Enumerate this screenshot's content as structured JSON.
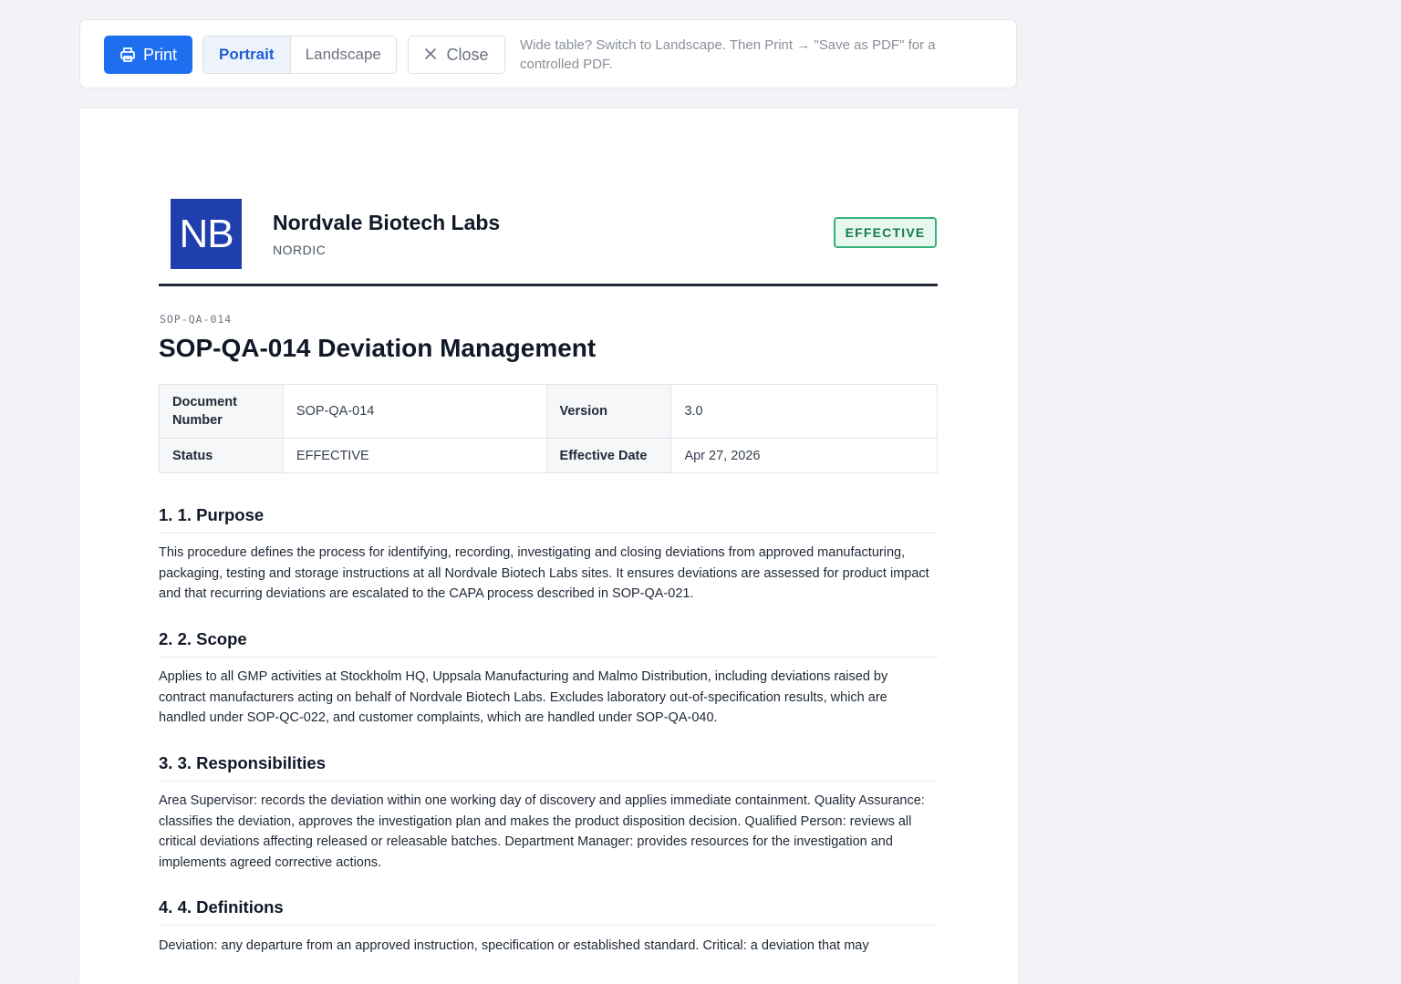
{
  "toolbar": {
    "print_label": "Print",
    "portrait_label": "Portrait",
    "landscape_label": "Landscape",
    "close_label": "Close",
    "hint": "Wide table? Switch to Landscape. Then Print → \"Save as PDF\" for a controlled PDF.",
    "print_icon": "printer-icon",
    "close_icon": "close-icon",
    "selected_orientation": "Portrait"
  },
  "header": {
    "logo_text": "NB",
    "company_name": "Nordvale Biotech Labs",
    "region": "NORDIC",
    "status_badge": "EFFECTIVE"
  },
  "document": {
    "code": "SOP-QA-014",
    "title": "SOP-QA-014 Deviation Management",
    "meta": {
      "doc_number_label": "Document Number",
      "doc_number_value": "SOP-QA-014",
      "version_label": "Version",
      "version_value": "3.0",
      "status_label": "Status",
      "status_value": "EFFECTIVE",
      "effective_date_label": "Effective Date",
      "effective_date_value": "Apr 27, 2026"
    },
    "sections": [
      {
        "title": "1. 1. Purpose",
        "body": "This procedure defines the process for identifying, recording, investigating and closing deviations from approved manufacturing, packaging, testing and storage instructions at all Nordvale Biotech Labs sites. It ensures deviations are assessed for product impact and that recurring deviations are escalated to the CAPA process described in SOP-QA-021."
      },
      {
        "title": "2. 2. Scope",
        "body": "Applies to all GMP activities at Stockholm HQ, Uppsala Manufacturing and Malmo Distribution, including deviations raised by contract manufacturers acting on behalf of Nordvale Biotech Labs. Excludes laboratory out-of-specification results, which are handled under SOP-QC-022, and customer complaints, which are handled under SOP-QA-040."
      },
      {
        "title": "3. 3. Responsibilities",
        "body": "Area Supervisor: records the deviation within one working day of discovery and applies immediate containment. Quality Assurance: classifies the deviation, approves the investigation plan and makes the product disposition decision. Qualified Person: reviews all critical deviations affecting released or releasable batches. Department Manager: provides resources for the investigation and implements agreed corrective actions."
      },
      {
        "title": "4. 4. Definitions",
        "body": "Deviation: any departure from an approved instruction, specification or established standard. Critical: a deviation that may"
      }
    ]
  },
  "colors": {
    "accent": "#1e6ff0",
    "logo_bg": "#1f3fae",
    "badge_border": "#34b27a",
    "badge_text": "#157a4d"
  }
}
